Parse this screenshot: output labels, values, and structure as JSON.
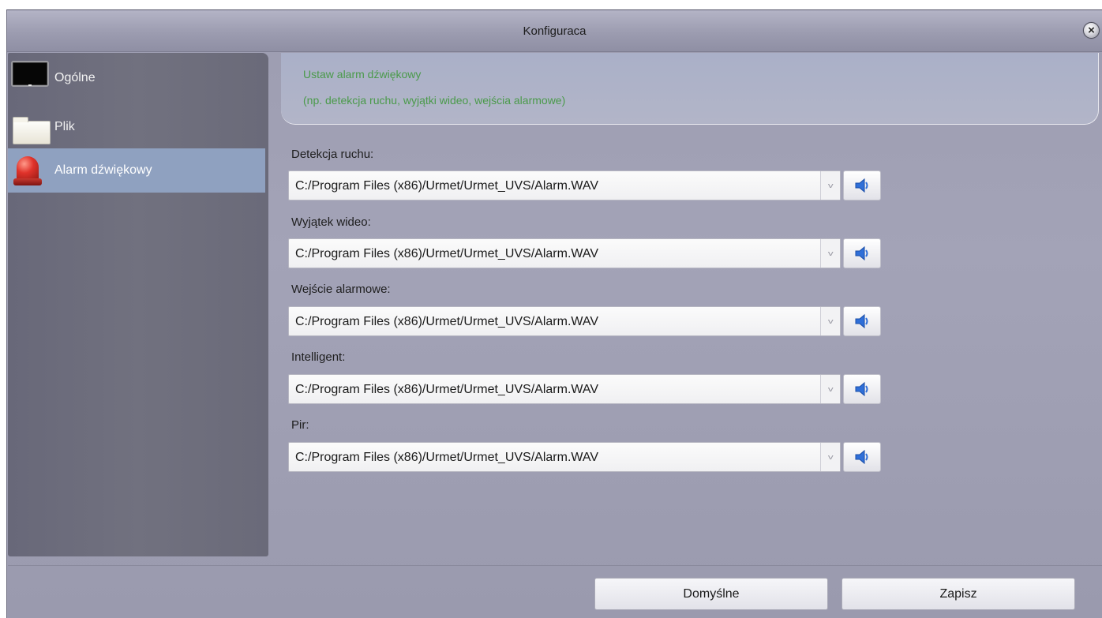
{
  "window": {
    "title": "Konfiguraca"
  },
  "sidebar": {
    "items": [
      {
        "label": "Ogólne",
        "icon": "monitor-icon",
        "selected": false
      },
      {
        "label": "Plik",
        "icon": "folder-icon",
        "selected": false
      },
      {
        "label": "Alarm dźwiękowy",
        "icon": "alarm-siren-icon",
        "selected": true
      }
    ]
  },
  "header": {
    "line1": "Ustaw alarm dźwiękowy",
    "line2": "(np. detekcja ruchu, wyjątki wideo, wejścia alarmowe)"
  },
  "fields": [
    {
      "label": "Detekcja ruchu:",
      "value": "C:/Program Files (x86)/Urmet/Urmet_UVS/Alarm.WAV"
    },
    {
      "label": "Wyjątek wideo:",
      "value": "C:/Program Files (x86)/Urmet/Urmet_UVS/Alarm.WAV"
    },
    {
      "label": "Wejście alarmowe:",
      "value": "C:/Program Files (x86)/Urmet/Urmet_UVS/Alarm.WAV"
    },
    {
      "label": "Intelligent:",
      "value": "C:/Program Files (x86)/Urmet/Urmet_UVS/Alarm.WAV"
    },
    {
      "label": "Pir:",
      "value": "C:/Program Files (x86)/Urmet/Urmet_UVS/Alarm.WAV"
    }
  ],
  "footer": {
    "default_label": "Domyślne",
    "save_label": "Zapisz"
  },
  "colors": {
    "header_text": "#4a9a4a",
    "selected_item": "#8fa1c0",
    "speaker_icon": "#2f6fd8"
  }
}
